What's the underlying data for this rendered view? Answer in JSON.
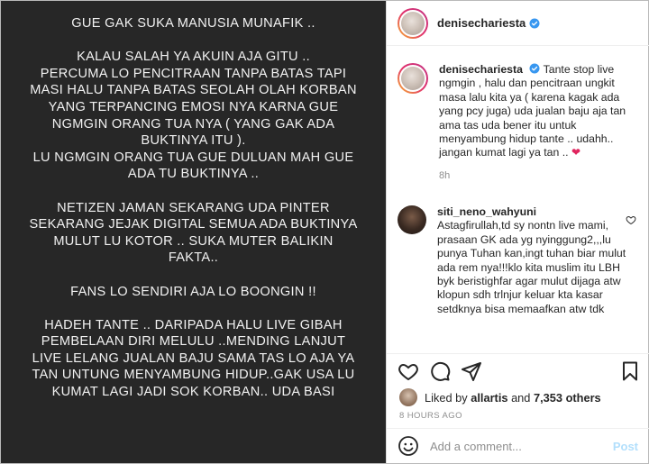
{
  "post": {
    "paragraphs": [
      "GUE GAK SUKA MANUSIA MUNAFIK ..",
      "KALAU SALAH YA AKUIN AJA GITU ..\nPERCUMA LO PENCITRAAN TANPA BATAS TAPI\nMASI HALU TANPA BATAS SEOLAH OLAH KORBAN\nYANG TERPANCING EMOSI NYA KARNA GUE\nNGMGIN ORANG TUA NYA ( YANG GAK ADA\nBUKTINYA ITU ).\nLU NGMGIN ORANG TUA GUE DULUAN MAH GUE\nADA TU BUKTINYA ..",
      "NETIZEN JAMAN SEKARANG UDA PINTER\nSEKARANG JEJAK DIGITAL SEMUA ADA BUKTINYA\nMULUT LU KOTOR .. SUKA MUTER BALIKIN\nFAKTA..",
      "FANS LO SENDIRI AJA LO BOONGIN  !!",
      "HADEH TANTE .. DARIPADA HALU LIVE GIBAH\nPEMBELAAN DIRI MELULU ..MENDING LANJUT\nLIVE LELANG JUALAN BAJU SAMA TAS LO AJA YA\nTAN UNTUNG MENYAMBUNG HIDUP..GAK USA LU\nKUMAT LAGI  JADI SOK KORBAN.. UDA BASI"
    ]
  },
  "header": {
    "username": "denisechariesta",
    "verified_icon": "verified-badge-icon"
  },
  "caption": {
    "username": "denisechariesta",
    "text": "Tante stop live ngmgin , halu dan pencitraan ungkit masa lalu kita ya ( karena kagak ada yang pcy juga) uda jualan baju aja tan ama tas uda bener itu untuk menyambung hidup tante .. udahh.. jangan kumat lagi ya tan .. ",
    "emoji": "❤",
    "time": "8h"
  },
  "comment": {
    "username": "siti_neno_wahyuni",
    "text": "Astagfirullah,td sy nontn live mami, prasaan GK ada yg nyinggung2,,,lu punya Tuhan kan,ingt tuhan biar mulut ada rem nya!!!klo kita muslim itu LBH byk beristighfar agar mulut dijaga atw klopun sdh trlnjur keluar kta kasar setdknya bisa memaafkan atw tdk"
  },
  "likes": {
    "prefix": "Liked by ",
    "user": "allartis",
    "middle": " and ",
    "count": "7,353 others"
  },
  "post_time": "8 HOURS AGO",
  "add_comment": {
    "placeholder": "Add a comment...",
    "post_label": "Post"
  },
  "colors": {
    "image_bg": "#272727",
    "verified": "#3897f0",
    "post_button": "#b2dffc"
  }
}
